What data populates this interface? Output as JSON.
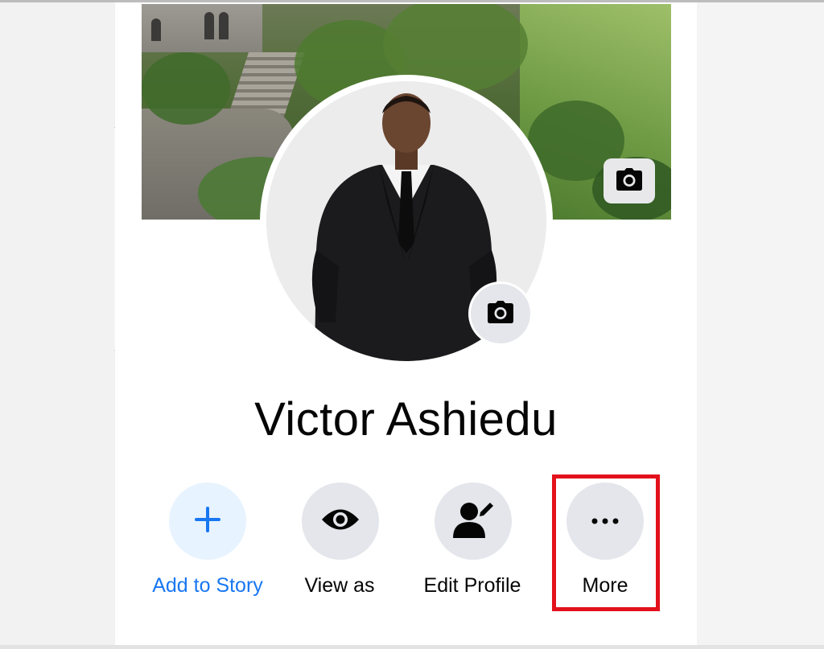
{
  "profile": {
    "name": "Victor Ashiedu"
  },
  "icons": {
    "cover_camera": "camera-icon",
    "avatar_camera": "camera-icon",
    "add_story": "plus-icon",
    "view_as": "eye-icon",
    "edit_profile": "person-edit-icon",
    "more": "ellipsis-icon"
  },
  "actions": {
    "add_story_label": "Add to Story",
    "view_as_label": "View as",
    "edit_profile_label": "Edit Profile",
    "more_label": "More"
  },
  "colors": {
    "accent": "#1877f2",
    "add_story_bg": "#e7f3ff",
    "neutral_bg": "#e4e6eb",
    "highlight": "#e3111b"
  }
}
